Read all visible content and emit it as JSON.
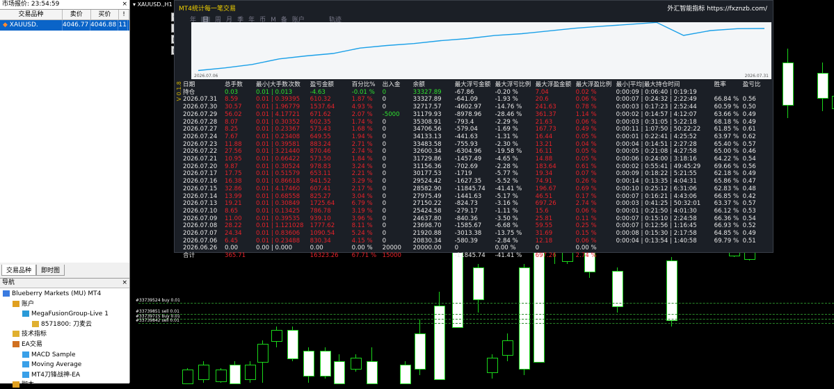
{
  "market_watch": {
    "title": "市场报价: 23:54:59",
    "close": "×",
    "columns": [
      "交易品种",
      "卖价",
      "买价",
      "!"
    ],
    "row": {
      "symbol": "XAUUSD.",
      "bid": "4046.77",
      "ask": "4046.88",
      "count": "11"
    },
    "tabs": [
      "交易品种",
      "即时图"
    ]
  },
  "navigator": {
    "title": "导航",
    "close": "×",
    "items": [
      {
        "label": "Blueberry Markets (MU) MT4",
        "icon": "terminal-icon",
        "indent": 0
      },
      {
        "label": "账户",
        "icon": "accounts-icon",
        "indent": 1
      },
      {
        "label": "MegaFusionGroup-Live 1",
        "icon": "server-icon",
        "indent": 2
      },
      {
        "label": "8571800: 刀麦云",
        "icon": "user-icon",
        "indent": 3
      },
      {
        "label": "技术指标",
        "icon": "indicators-icon",
        "indent": 1
      },
      {
        "label": "EA交易",
        "icon": "expert-advisors-icon",
        "indent": 1
      },
      {
        "label": "MACD Sample",
        "icon": "ea-icon",
        "indent": 2
      },
      {
        "label": "Moving Average",
        "icon": "ea-icon",
        "indent": 2
      },
      {
        "label": "MT4刀锋战神-EA",
        "icon": "ea-icon",
        "indent": 2
      },
      {
        "label": "脚本",
        "icon": "scripts-icon",
        "indent": 1
      }
    ]
  },
  "chart": {
    "title": "XAUUSD.,H1",
    "order_lines": [
      "#33739524 buy 0.01",
      "#33739851 sell 0.01",
      "#33739715 buy 0.01",
      "#33739842 sell 0.01"
    ],
    "candle_color": "#1ad81a"
  },
  "panel": {
    "title": "MT4统计每一笔交易",
    "brand": "外汇智能指标 https://fxznzb.com/",
    "tabs": [
      "年",
      "日",
      "周",
      "月",
      "季",
      "年",
      "币",
      "M",
      "备",
      "账户",
      "",
      "",
      "轨迹"
    ],
    "selected_tab": "日",
    "curve_date_start": "2026.07.06",
    "curve_date_end": "2026.07.31",
    "vertical_label": "V 0.1.8",
    "headers": [
      "日期",
      "总手数",
      "最小|大手数",
      "次数",
      "盈亏金额",
      "百分比%",
      "出入金",
      "余额",
      "最大浮亏金额",
      "最大浮亏比例",
      "最大浮盈金额",
      "最大浮盈比例",
      "最小|平均|最大持仓时间",
      "胜率",
      "盈亏比"
    ],
    "rows": [
      {
        "c": [
          "持仓",
          "0.03",
          "0.01 | 0.01",
          "3",
          "-4.63",
          "-0.01 %",
          "0",
          "33327.89",
          "-67.86",
          "-0.20 %",
          "7.04",
          "0.02 %",
          "0:00:09 | 0:06:40 | 0:19:19",
          "",
          ""
        ],
        "k": "g"
      },
      {
        "c": [
          "2026.07.31",
          "8.59",
          "0.01 | 0.39",
          "395",
          "610.32",
          "1.87 %",
          "0",
          "33327.89",
          "-641.09",
          "-1.93 %",
          "20.6",
          "0.06 %",
          "0:00:07 | 0:24:32 | 2:22:49",
          "66.84 %",
          "0.56"
        ],
        "k": "r"
      },
      {
        "c": [
          "2026.07.30",
          "30.57",
          "0.01 | 1.96",
          "779",
          "1537.64",
          "4.93 %",
          "0",
          "32717.57",
          "-4602.97",
          "-14.76 %",
          "241.63",
          "0.78 %",
          "0:00:03 | 0:17:23 | 2:52:44",
          "60.59 %",
          "0.50"
        ],
        "k": "r"
      },
      {
        "c": [
          "2026.07.29",
          "56.02",
          "0.01 | 4.17",
          "721",
          "671.62",
          "2.07 %",
          "-5000",
          "31179.93",
          "-8978.96",
          "-28.46 %",
          "361.37",
          "1.14 %",
          "0:00:02 | 0:14:57 | 4:12:07",
          "63.66 %",
          "0.49"
        ],
        "k": "r"
      },
      {
        "c": [
          "2026.07.28",
          "8.07",
          "0.01 | 0.30",
          "352",
          "602.35",
          "1.74 %",
          "0",
          "35308.91",
          "-793.4",
          "-2.29 %",
          "21.63",
          "0.06 %",
          "0:00:03 | 0:31:05 | 5:22:18",
          "68.18 %",
          "0.49"
        ],
        "k": "r"
      },
      {
        "c": [
          "2026.07.27",
          "8.25",
          "0.01 | 0.23",
          "367",
          "573.43",
          "1.68 %",
          "0",
          "34706.56",
          "-579.04",
          "-1.69 %",
          "167.73",
          "0.49 %",
          "0:00:11 | 1:07:50 | 50:22:22",
          "61.85 %",
          "0.61"
        ],
        "k": "r"
      },
      {
        "c": [
          "2026.07.24",
          "7.67",
          "0.01 | 0.23",
          "408",
          "649.55",
          "1.94 %",
          "0",
          "34133.13",
          "-441.63",
          "-1.31 %",
          "16.44",
          "0.05 %",
          "0:00:01 | 0:22:41 | 4:25:52",
          "63.97 %",
          "0.62"
        ],
        "k": "r"
      },
      {
        "c": [
          "2026.07.23",
          "11.88",
          "0.01 | 0.39",
          "581",
          "883.24",
          "2.71 %",
          "0",
          "33483.58",
          "-755.93",
          "-2.30 %",
          "13.21",
          "0.04 %",
          "0:00:04 | 0:14:51 | 2:27:28",
          "65.40 %",
          "0.57"
        ],
        "k": "r"
      },
      {
        "c": [
          "2026.07.22",
          "27.56",
          "0.01 | 3.21",
          "440",
          "870.46",
          "2.74 %",
          "0",
          "32600.34",
          "-6304.96",
          "-19.58 %",
          "16.11",
          "0.05 %",
          "0:00:05 | 0:21:08 | 4:27:58",
          "65.00 %",
          "0.46"
        ],
        "k": "r"
      },
      {
        "c": [
          "2026.07.21",
          "10.95",
          "0.01 | 0.66",
          "422",
          "573.50",
          "1.84 %",
          "0",
          "31729.86",
          "-1457.49",
          "-4.65 %",
          "14.88",
          "0.05 %",
          "0:00:06 | 0:24:00 | 3:18:16",
          "64.22 %",
          "0.54"
        ],
        "k": "r"
      },
      {
        "c": [
          "2026.07.20",
          "9.87",
          "0.01 | 0.30",
          "524",
          "978.83",
          "3.24 %",
          "0",
          "31156.36",
          "-702.69",
          "-2.28 %",
          "183.64",
          "0.61 %",
          "0:00:02 | 0:55:41 | 49:45:29",
          "69.66 %",
          "0.56"
        ],
        "k": "r"
      },
      {
        "c": [
          "2026.07.17",
          "17.75",
          "0.01 | 0.51",
          "579",
          "653.11",
          "2.21 %",
          "0",
          "30177.53",
          "-1719",
          "-5.77 %",
          "19.34",
          "0.07 %",
          "0:00:09 | 0:18:22 | 5:21:55",
          "62.18 %",
          "0.49"
        ],
        "k": "r"
      },
      {
        "c": [
          "2026.07.16",
          "16.38",
          "0.01 | 0.86",
          "618",
          "941.52",
          "3.29 %",
          "0",
          "29524.42",
          "-1627.35",
          "-5.52 %",
          "74.91",
          "0.26 %",
          "0:00:14 | 0:13:35 | 4:04:31",
          "65.86 %",
          "0.47"
        ],
        "k": "r"
      },
      {
        "c": [
          "2026.07.15",
          "32.86",
          "0.01 | 4.17",
          "460",
          "607.41",
          "2.17 %",
          "0",
          "28582.90",
          "-11845.74",
          "-41.41 %",
          "196.67",
          "0.69 %",
          "0:00:10 | 0:25:12 | 6:31:06",
          "62.83 %",
          "0.48"
        ],
        "k": "r"
      },
      {
        "c": [
          "2026.07.14",
          "13.99",
          "0.01 | 0.68",
          "558",
          "825.27",
          "3.04 %",
          "0",
          "27975.49",
          "-1441.63",
          "-5.17 %",
          "46.51",
          "0.17 %",
          "0:00:07 | 0:16:21 | 4:43:06",
          "66.85 %",
          "0.42"
        ],
        "k": "r"
      },
      {
        "c": [
          "2026.07.13",
          "19.21",
          "0.01 | 0.30",
          "849",
          "1725.64",
          "6.79 %",
          "0",
          "27150.22",
          "-824.73",
          "-3.16 %",
          "697.26",
          "2.74 %",
          "0:00:03 | 0:41:25 | 50:32:01",
          "63.37 %",
          "0.57"
        ],
        "k": "r"
      },
      {
        "c": [
          "2026.07.10",
          "8.65",
          "0.01 | 0.13",
          "425",
          "786.78",
          "3.19 %",
          "0",
          "25424.58",
          "-279.17",
          "-1.11 %",
          "15.6",
          "0.06 %",
          "0:00:01 | 0:21:50 | 4:01:30",
          "66.12 %",
          "0.53"
        ],
        "k": "r"
      },
      {
        "c": [
          "2026.07.09",
          "11.00",
          "0.01 | 0.39",
          "535",
          "939.10",
          "3.96 %",
          "0",
          "24637.80",
          "-840.36",
          "-3.50 %",
          "25.81",
          "0.11 %",
          "0:00:07 | 0:15:10 | 2:24:58",
          "66.36 %",
          "0.54"
        ],
        "k": "r"
      },
      {
        "c": [
          "2026.07.08",
          "28.22",
          "0.01 | 1.12",
          "1028",
          "1777.62",
          "8.11 %",
          "0",
          "23698.70",
          "-1585.67",
          "-6.68 %",
          "59.55",
          "0.25 %",
          "0:00:07 | 0:12:56 | 1:16:45",
          "66.93 %",
          "0.52"
        ],
        "k": "r"
      },
      {
        "c": [
          "2026.07.07",
          "24.34",
          "0.01 | 0.83",
          "606",
          "1090.54",
          "5.24 %",
          "0",
          "21920.88",
          "-3013.38",
          "-13.75 %",
          "31.69",
          "0.15 %",
          "0:00:08 | 0:15:30 | 2:17:58",
          "64.85 %",
          "0.49"
        ],
        "k": "r"
      },
      {
        "c": [
          "2026.07.06",
          "6.45",
          "0.01 | 0.23",
          "488",
          "830.34",
          "4.15 %",
          "0",
          "20830.34",
          "-580.39",
          "-2.84 %",
          "12.18",
          "0.06 %",
          "0:00:04 | 0:13:54 | 1:40:58",
          "69.79 %",
          "0.51"
        ],
        "k": "r"
      },
      {
        "c": [
          "2026.06.26",
          "0.00",
          "0.00 | 0.00",
          "0",
          "0.00",
          "0.00 %",
          "20000",
          "20000.00",
          "0",
          "0.00 %",
          "0",
          "0.00 %",
          "",
          "",
          ""
        ],
        "k": "w"
      },
      {
        "c": [
          "合计",
          "365.71",
          "",
          "",
          "16323.26",
          "67.71 %",
          "15000",
          "",
          "-11845.74",
          "-41.41 %",
          "697.26",
          "2.74 %",
          "",
          "",
          ""
        ],
        "k": "t"
      }
    ],
    "equity_curve": [
      20000,
      20830,
      21921,
      23699,
      24638,
      25425,
      27150,
      27975,
      28583,
      29524,
      30178,
      31156,
      31730,
      32600,
      33484,
      34133,
      34707,
      35309,
      31180,
      32718,
      33328,
      33400
    ]
  }
}
